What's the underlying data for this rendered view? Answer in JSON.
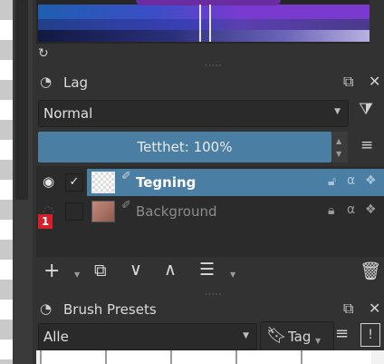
{
  "colors": {
    "accent": "#4a7fa3",
    "panel_bg": "#323232",
    "badge": "#d61f2a"
  },
  "color_selector": {
    "refresh_icon": "refresh-icon"
  },
  "layers_panel": {
    "title": "Lag",
    "blend_mode": "Normal",
    "opacity_label": "Tetthet:  100%",
    "opacity_value": 100,
    "layers": [
      {
        "name": "Tegning",
        "visible": true,
        "checked": true,
        "selected": true
      },
      {
        "name": "Background",
        "visible": false,
        "checked": false,
        "selected": false
      }
    ],
    "badge": "1"
  },
  "brush_presets": {
    "title": "Brush Presets",
    "tag_filter": "Alle",
    "tag_button": "Tag"
  }
}
